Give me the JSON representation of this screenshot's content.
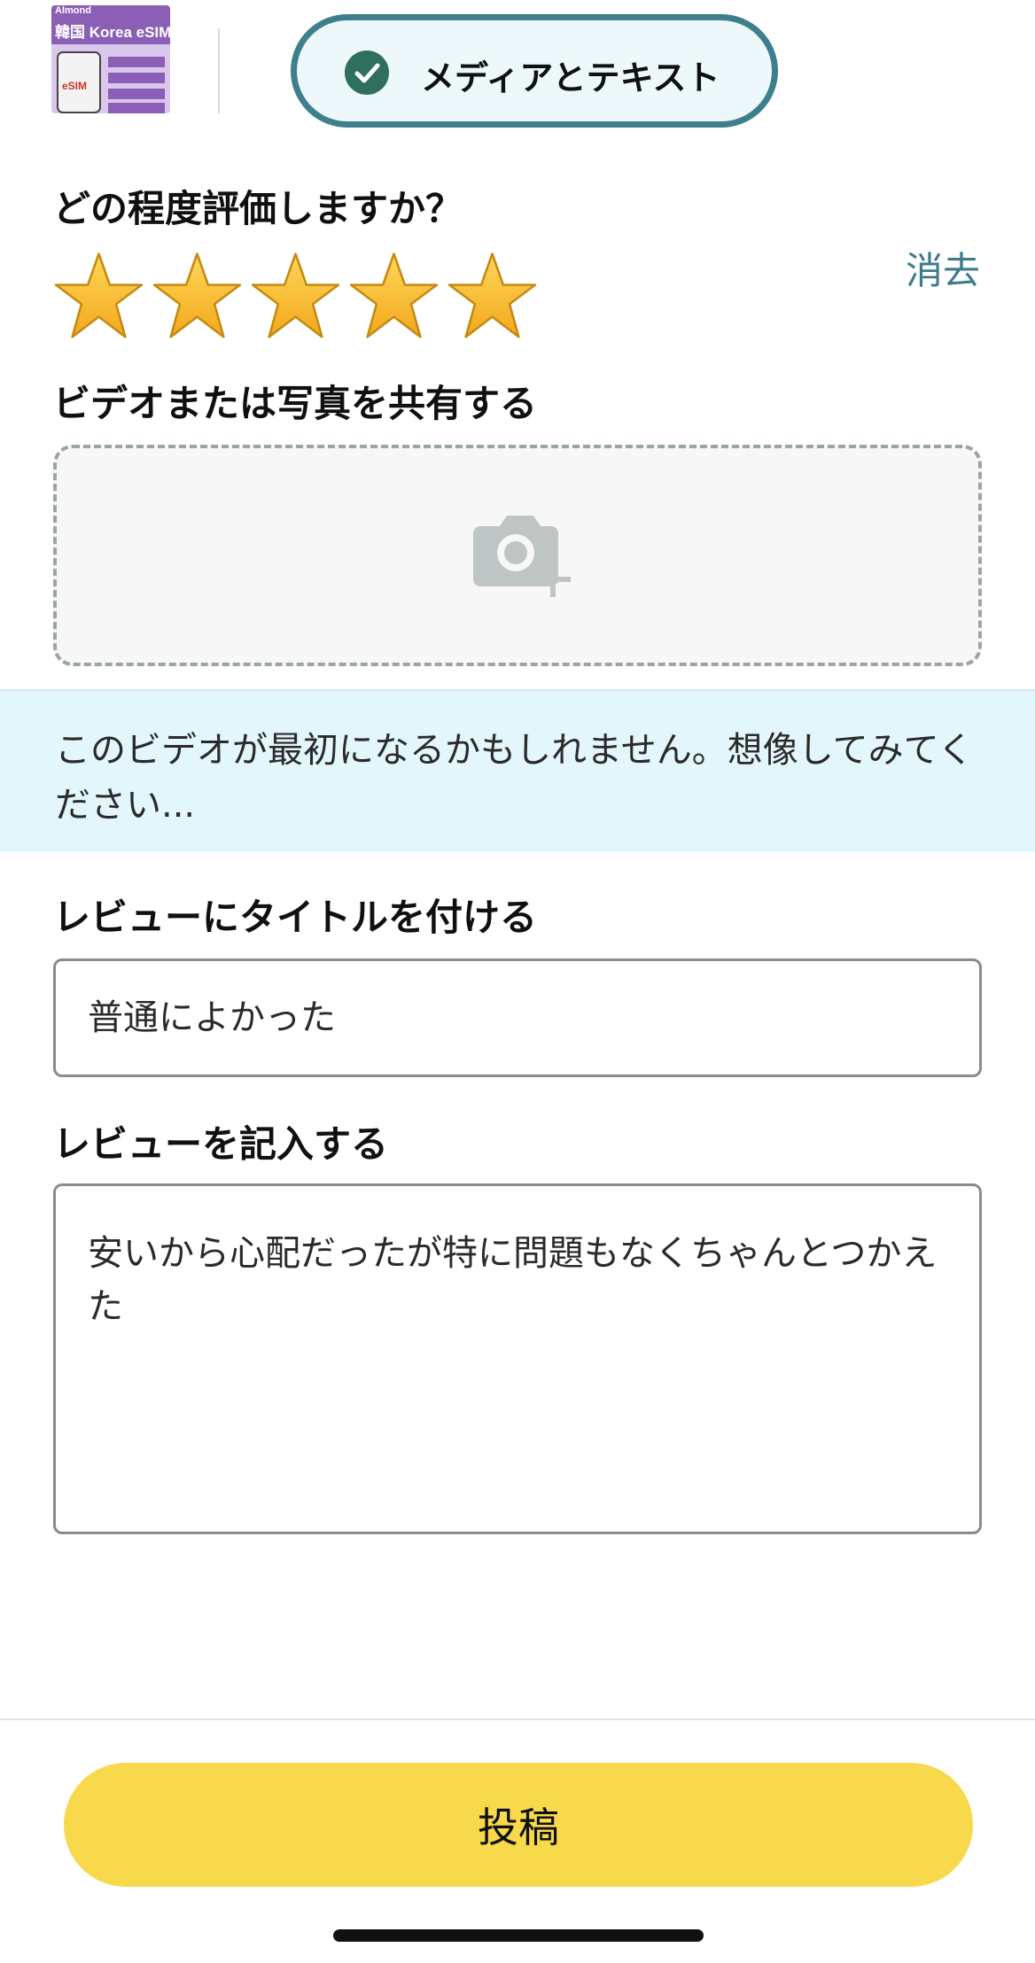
{
  "header": {
    "product_thumbnail": {
      "brand": "Almond",
      "title": "韓国 Korea eSIM",
      "badge": "eSIM"
    },
    "mode_pill": {
      "label": "メディアとテキスト",
      "icon": "check-circle-icon"
    }
  },
  "rating": {
    "heading": "どの程度評価しますか？",
    "clear_label": "消去",
    "stars_filled": 5,
    "stars_total": 5,
    "star_color": "#f6b827"
  },
  "media": {
    "heading": "ビデオまたは写真を共有する",
    "upload_icon": "camera-add-icon",
    "hint": "このビデオが最初になるかもしれません。想像してみてください..."
  },
  "review_title": {
    "heading": "レビューにタイトルを付ける",
    "value": "普通によかった"
  },
  "review_body": {
    "heading": "レビューを記入する",
    "value": "安いから心配だったが特に問題もなくちゃんとつかえた"
  },
  "footer": {
    "submit_label": "投稿",
    "submit_color": "#f8d94b"
  }
}
